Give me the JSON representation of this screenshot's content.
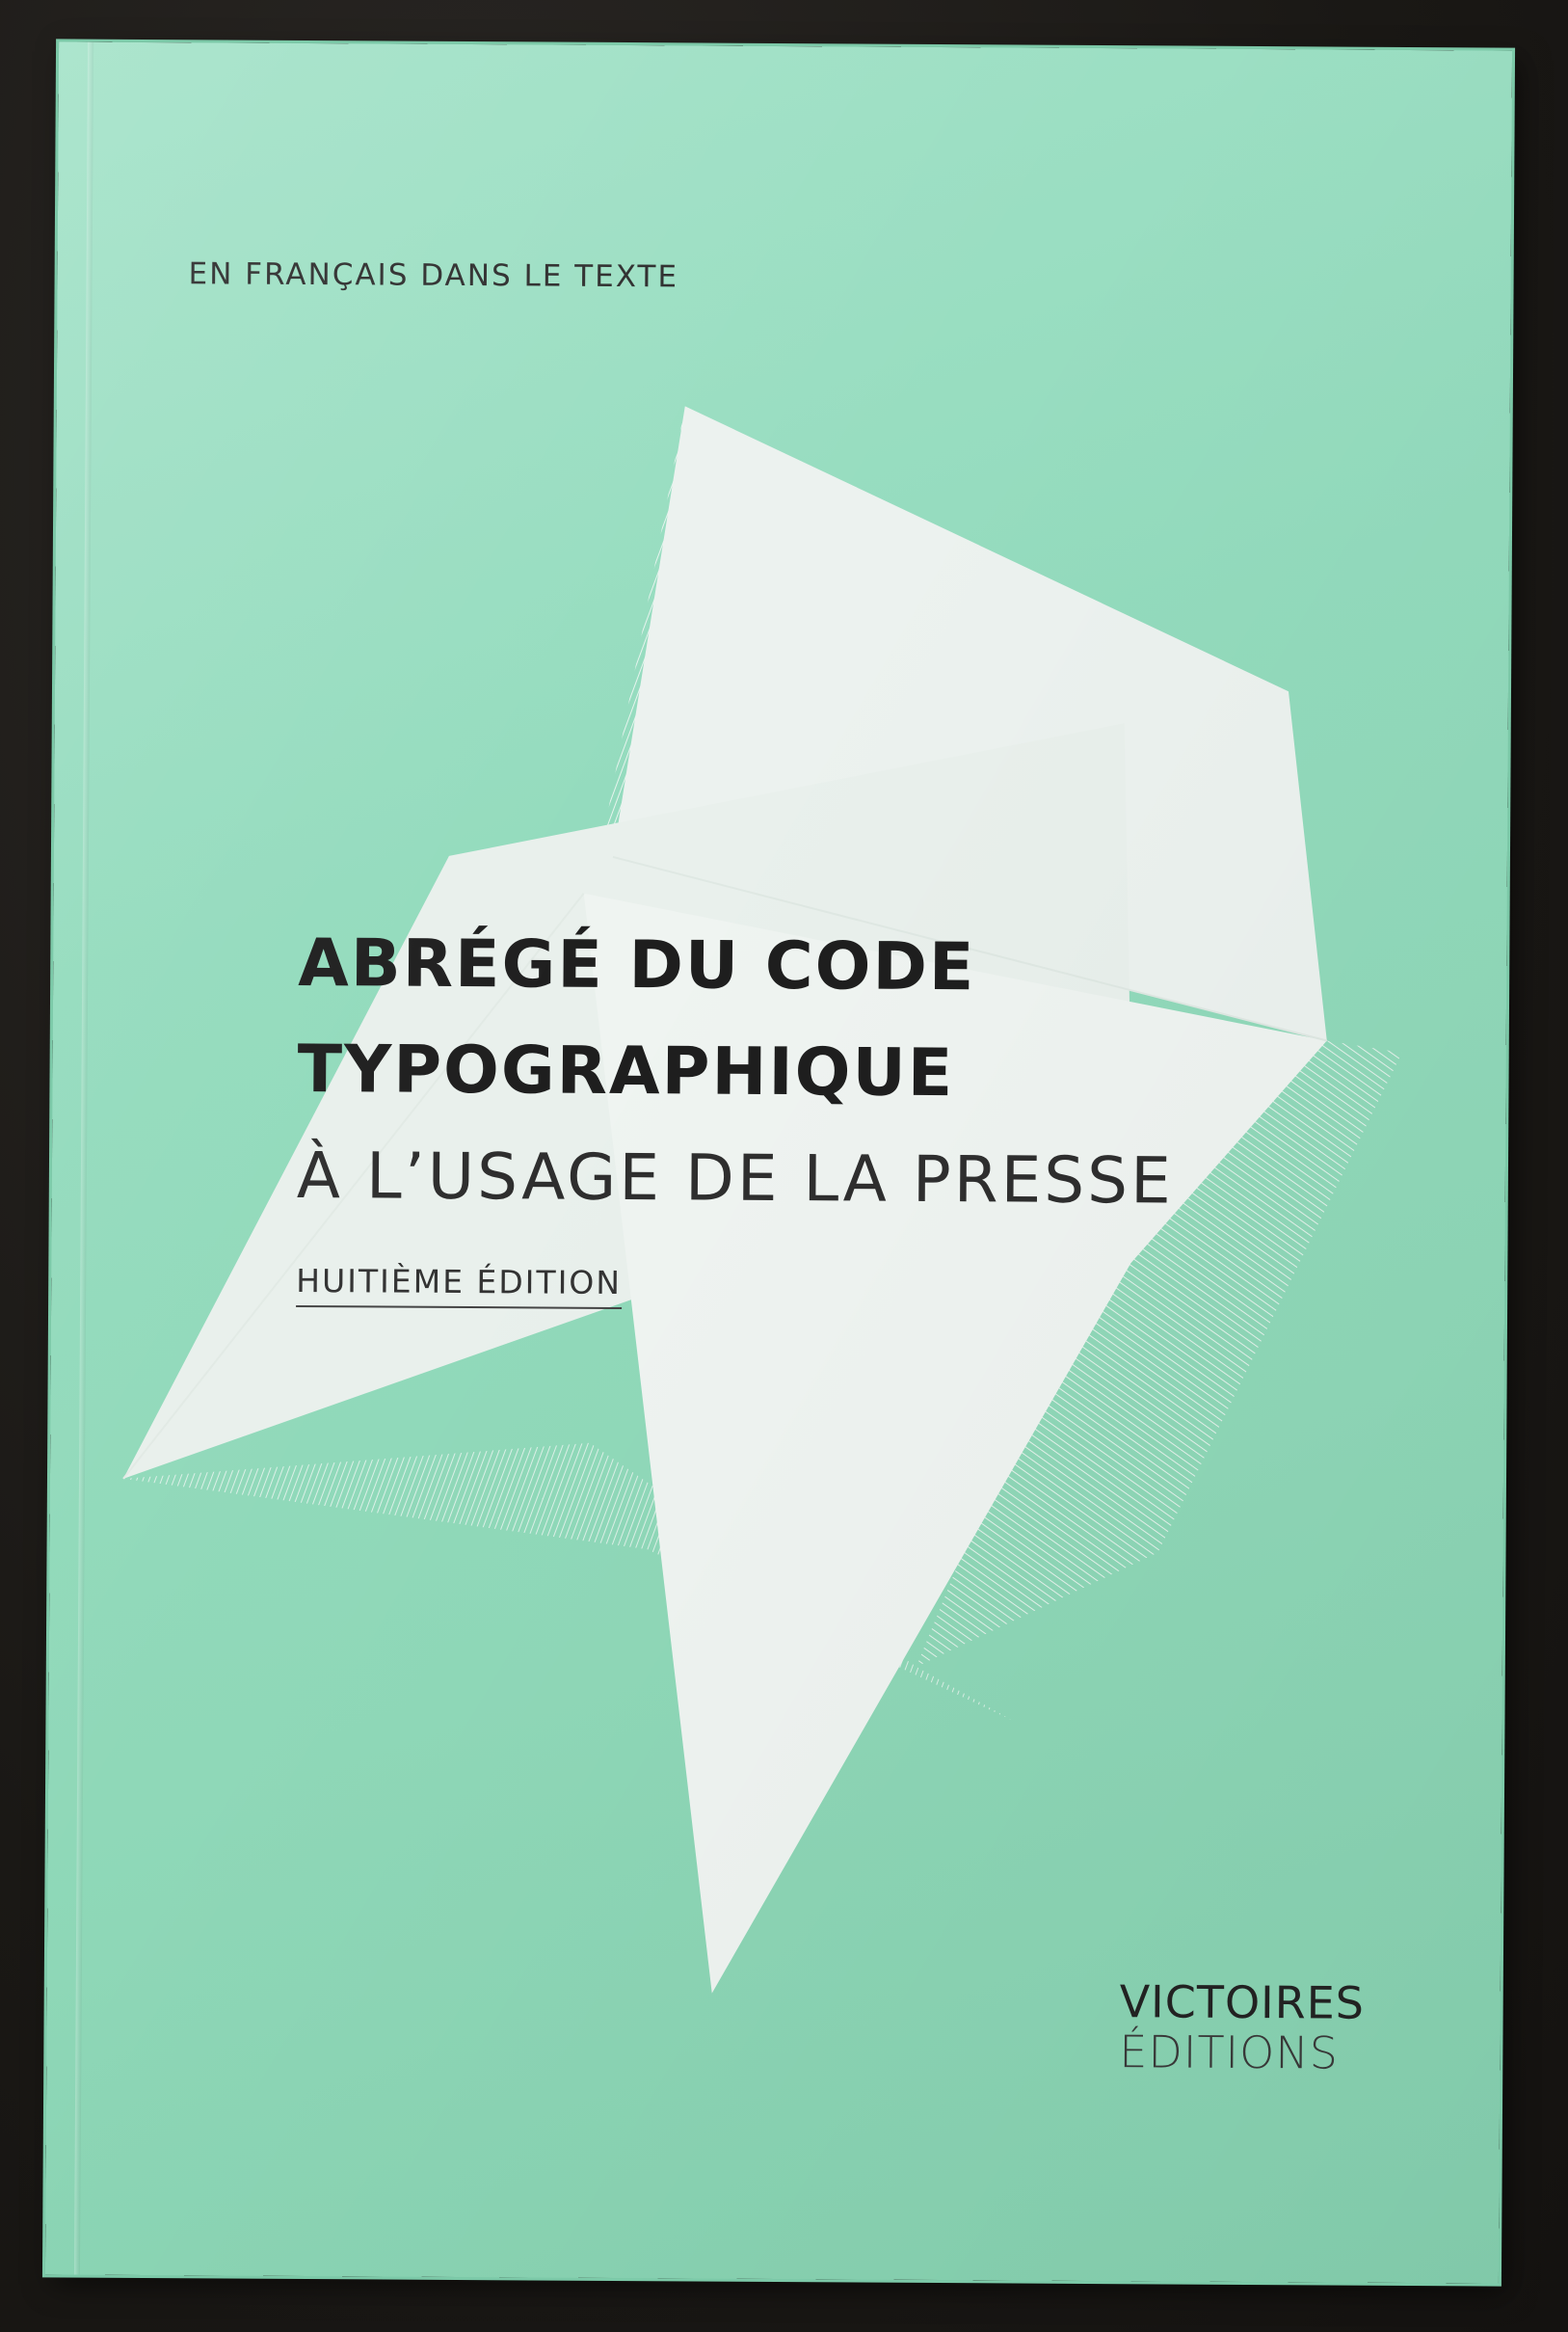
{
  "cover": {
    "series": "EN FRANÇAIS DANS LE TEXTE",
    "title_line_1": "ABRÉGÉ DU CODE",
    "title_line_2": "TYPOGRAPHIQUE",
    "subtitle": "À L’USAGE DE LA PRESSE",
    "edition": "HUITIÈME ÉDITION",
    "publisher_line_1": "VICTOIRES",
    "publisher_line_2": "ÉDITIONS"
  },
  "colors": {
    "cover_green": "#93dbbd",
    "shape_white": "#ebf1ee",
    "text_dark": "#1e1e1e",
    "background": "#1d1b18"
  }
}
